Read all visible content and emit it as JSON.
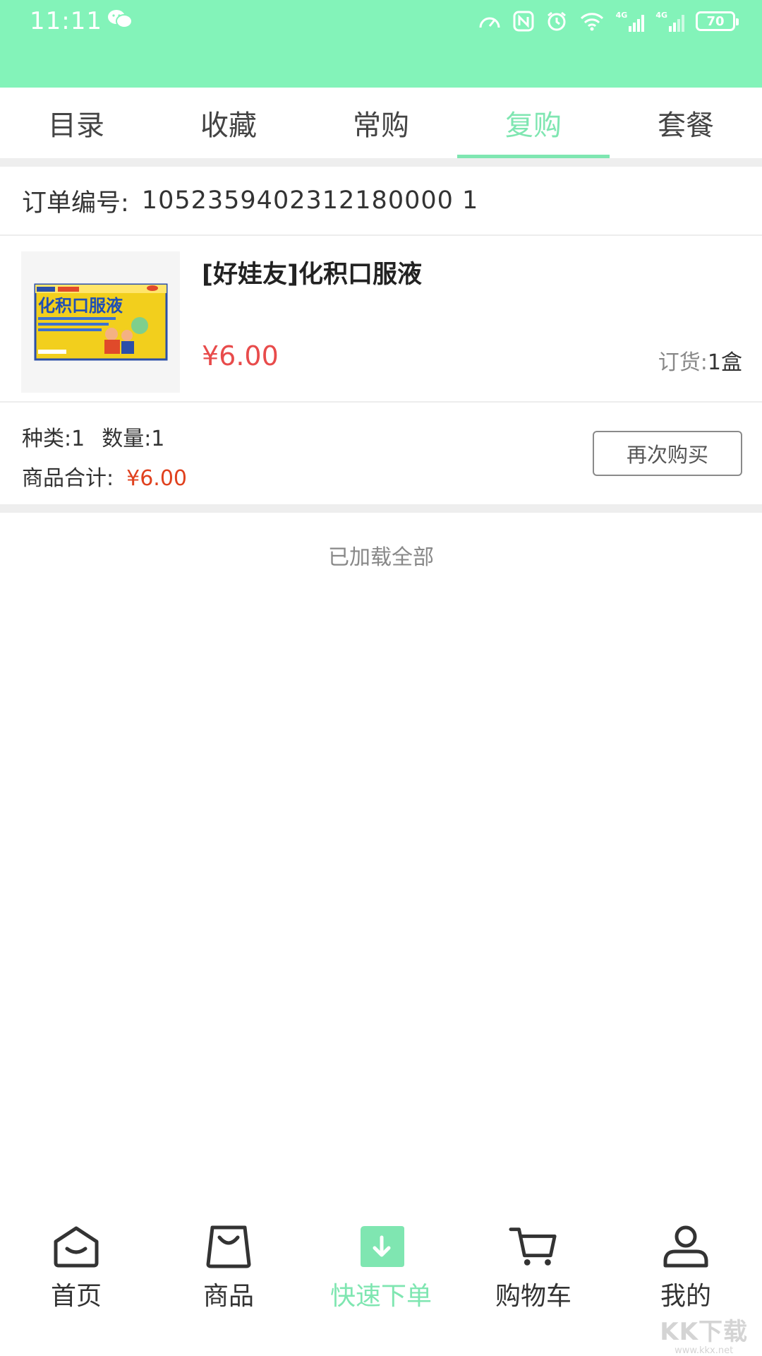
{
  "status_bar": {
    "time": "11:11",
    "battery": "70",
    "network_1": "4G",
    "network_2": "4G"
  },
  "tabs": [
    {
      "label": "目录",
      "active": false
    },
    {
      "label": "收藏",
      "active": false
    },
    {
      "label": "常购",
      "active": false
    },
    {
      "label": "复购",
      "active": true
    },
    {
      "label": "套餐",
      "active": false
    }
  ],
  "order": {
    "number_label": "订单编号:",
    "number": "1052359402312180000 1",
    "product": {
      "name": "[好娃友]化积口服液",
      "image_text": "化积口服液",
      "price": "¥6.00",
      "qty_label": "订货:",
      "qty_value": "1盒"
    },
    "summary": {
      "kinds": "种类:1",
      "count": "数量:1",
      "total_label": "商品合计:",
      "total_value": "¥6.00"
    },
    "rebuy_label": "再次购买"
  },
  "list_end_text": "已加载全部",
  "bottom_nav": [
    {
      "label": "首页",
      "icon": "home-icon",
      "active": false
    },
    {
      "label": "商品",
      "icon": "shopping-bag-icon",
      "active": false
    },
    {
      "label": "快速下单",
      "icon": "quick-order-icon",
      "active": true
    },
    {
      "label": "购物车",
      "icon": "cart-icon",
      "active": false
    },
    {
      "label": "我的",
      "icon": "user-icon",
      "active": false
    }
  ],
  "watermark": {
    "main": "KK下载",
    "sub": "www.kkx.net"
  },
  "colors": {
    "header": "#83f3b9",
    "accent": "#7fe6b1",
    "price": "#e84b4b",
    "total": "#e0411e"
  }
}
